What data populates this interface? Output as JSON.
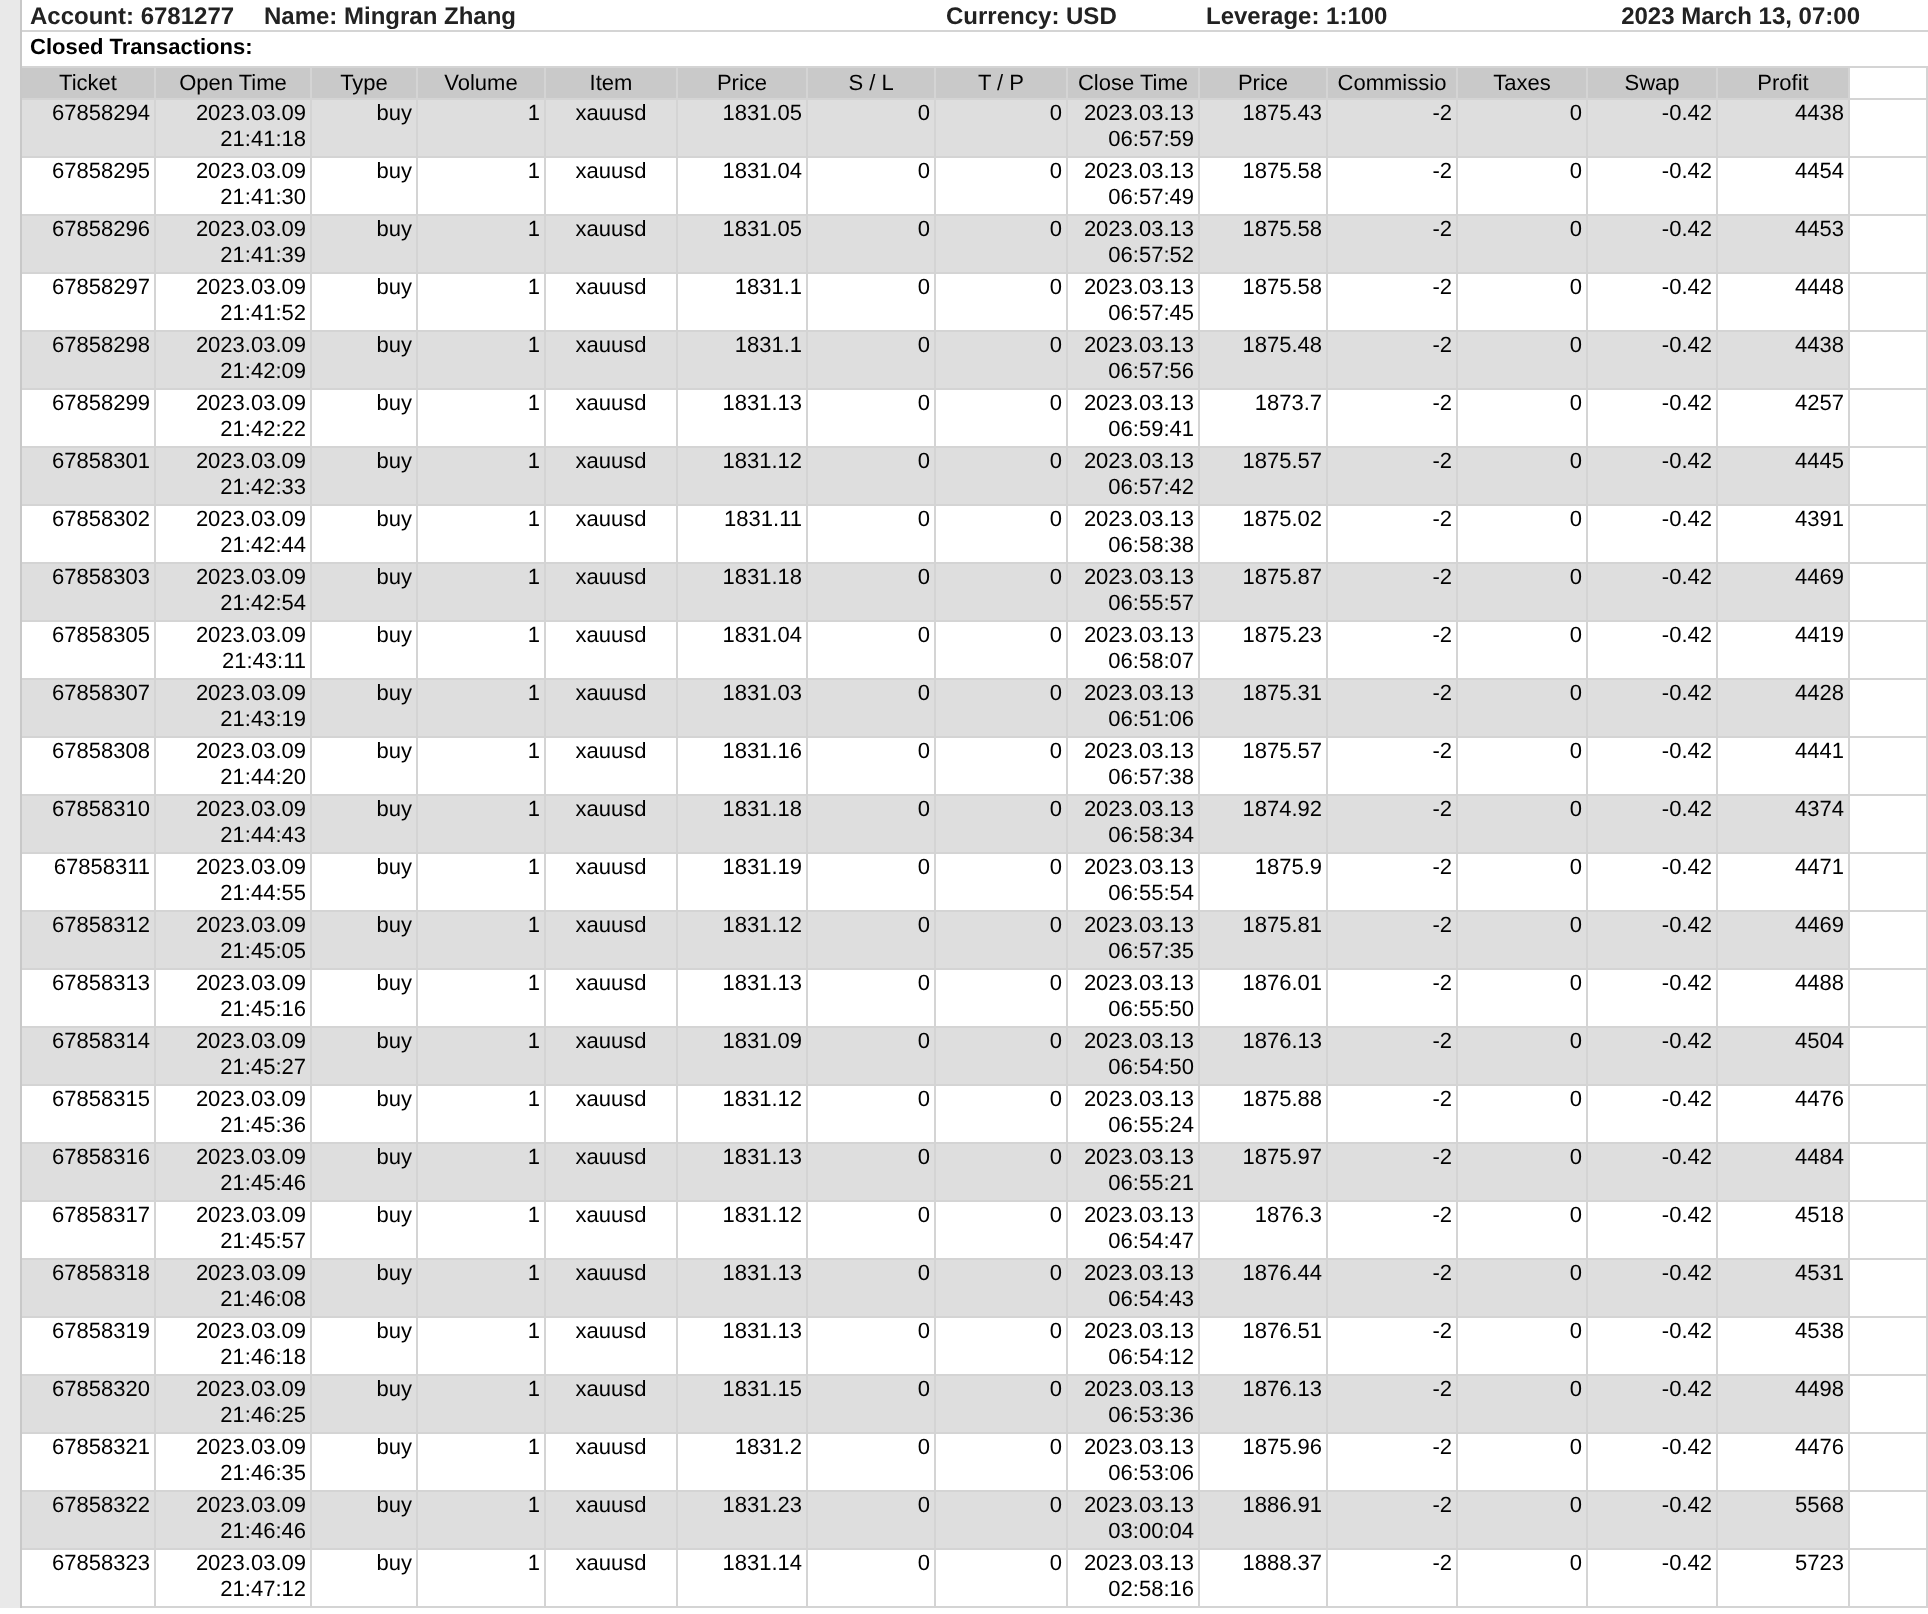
{
  "report_header": {
    "account": "Account: 6781277",
    "name": "Name: Mingran Zhang",
    "currency": "Currency: USD",
    "leverage": "Leverage: 1:100",
    "date": "2023 March 13, 07:00"
  },
  "section_title": "Closed Transactions:",
  "table": {
    "columns": [
      "Ticket",
      "Open Time",
      "Type",
      "Volume",
      "Item",
      "Price",
      "S / L",
      "T / P",
      "Close Time",
      "Price",
      "Commissio",
      "Taxes",
      "Swap",
      "Profit"
    ],
    "rows": [
      {
        "ticket": "67858294",
        "open_time": "2023.03.09 21:41:18",
        "type": "buy",
        "volume": "1",
        "item": "xauusd",
        "open_price": "1831.05",
        "sl": "0",
        "tp": "0",
        "close_time": "2023.03.13 06:57:59",
        "close_price": "1875.43",
        "commission": "-2",
        "taxes": "0",
        "swap": "-0.42",
        "profit": "4438"
      },
      {
        "ticket": "67858295",
        "open_time": "2023.03.09 21:41:30",
        "type": "buy",
        "volume": "1",
        "item": "xauusd",
        "open_price": "1831.04",
        "sl": "0",
        "tp": "0",
        "close_time": "2023.03.13 06:57:49",
        "close_price": "1875.58",
        "commission": "-2",
        "taxes": "0",
        "swap": "-0.42",
        "profit": "4454"
      },
      {
        "ticket": "67858296",
        "open_time": "2023.03.09 21:41:39",
        "type": "buy",
        "volume": "1",
        "item": "xauusd",
        "open_price": "1831.05",
        "sl": "0",
        "tp": "0",
        "close_time": "2023.03.13 06:57:52",
        "close_price": "1875.58",
        "commission": "-2",
        "taxes": "0",
        "swap": "-0.42",
        "profit": "4453"
      },
      {
        "ticket": "67858297",
        "open_time": "2023.03.09 21:41:52",
        "type": "buy",
        "volume": "1",
        "item": "xauusd",
        "open_price": "1831.1",
        "sl": "0",
        "tp": "0",
        "close_time": "2023.03.13 06:57:45",
        "close_price": "1875.58",
        "commission": "-2",
        "taxes": "0",
        "swap": "-0.42",
        "profit": "4448"
      },
      {
        "ticket": "67858298",
        "open_time": "2023.03.09 21:42:09",
        "type": "buy",
        "volume": "1",
        "item": "xauusd",
        "open_price": "1831.1",
        "sl": "0",
        "tp": "0",
        "close_time": "2023.03.13 06:57:56",
        "close_price": "1875.48",
        "commission": "-2",
        "taxes": "0",
        "swap": "-0.42",
        "profit": "4438"
      },
      {
        "ticket": "67858299",
        "open_time": "2023.03.09 21:42:22",
        "type": "buy",
        "volume": "1",
        "item": "xauusd",
        "open_price": "1831.13",
        "sl": "0",
        "tp": "0",
        "close_time": "2023.03.13 06:59:41",
        "close_price": "1873.7",
        "commission": "-2",
        "taxes": "0",
        "swap": "-0.42",
        "profit": "4257"
      },
      {
        "ticket": "67858301",
        "open_time": "2023.03.09 21:42:33",
        "type": "buy",
        "volume": "1",
        "item": "xauusd",
        "open_price": "1831.12",
        "sl": "0",
        "tp": "0",
        "close_time": "2023.03.13 06:57:42",
        "close_price": "1875.57",
        "commission": "-2",
        "taxes": "0",
        "swap": "-0.42",
        "profit": "4445"
      },
      {
        "ticket": "67858302",
        "open_time": "2023.03.09 21:42:44",
        "type": "buy",
        "volume": "1",
        "item": "xauusd",
        "open_price": "1831.11",
        "sl": "0",
        "tp": "0",
        "close_time": "2023.03.13 06:58:38",
        "close_price": "1875.02",
        "commission": "-2",
        "taxes": "0",
        "swap": "-0.42",
        "profit": "4391"
      },
      {
        "ticket": "67858303",
        "open_time": "2023.03.09 21:42:54",
        "type": "buy",
        "volume": "1",
        "item": "xauusd",
        "open_price": "1831.18",
        "sl": "0",
        "tp": "0",
        "close_time": "2023.03.13 06:55:57",
        "close_price": "1875.87",
        "commission": "-2",
        "taxes": "0",
        "swap": "-0.42",
        "profit": "4469"
      },
      {
        "ticket": "67858305",
        "open_time": "2023.03.09 21:43:11",
        "type": "buy",
        "volume": "1",
        "item": "xauusd",
        "open_price": "1831.04",
        "sl": "0",
        "tp": "0",
        "close_time": "2023.03.13 06:58:07",
        "close_price": "1875.23",
        "commission": "-2",
        "taxes": "0",
        "swap": "-0.42",
        "profit": "4419"
      },
      {
        "ticket": "67858307",
        "open_time": "2023.03.09 21:43:19",
        "type": "buy",
        "volume": "1",
        "item": "xauusd",
        "open_price": "1831.03",
        "sl": "0",
        "tp": "0",
        "close_time": "2023.03.13 06:51:06",
        "close_price": "1875.31",
        "commission": "-2",
        "taxes": "0",
        "swap": "-0.42",
        "profit": "4428"
      },
      {
        "ticket": "67858308",
        "open_time": "2023.03.09 21:44:20",
        "type": "buy",
        "volume": "1",
        "item": "xauusd",
        "open_price": "1831.16",
        "sl": "0",
        "tp": "0",
        "close_time": "2023.03.13 06:57:38",
        "close_price": "1875.57",
        "commission": "-2",
        "taxes": "0",
        "swap": "-0.42",
        "profit": "4441"
      },
      {
        "ticket": "67858310",
        "open_time": "2023.03.09 21:44:43",
        "type": "buy",
        "volume": "1",
        "item": "xauusd",
        "open_price": "1831.18",
        "sl": "0",
        "tp": "0",
        "close_time": "2023.03.13 06:58:34",
        "close_price": "1874.92",
        "commission": "-2",
        "taxes": "0",
        "swap": "-0.42",
        "profit": "4374"
      },
      {
        "ticket": "67858311",
        "open_time": "2023.03.09 21:44:55",
        "type": "buy",
        "volume": "1",
        "item": "xauusd",
        "open_price": "1831.19",
        "sl": "0",
        "tp": "0",
        "close_time": "2023.03.13 06:55:54",
        "close_price": "1875.9",
        "commission": "-2",
        "taxes": "0",
        "swap": "-0.42",
        "profit": "4471"
      },
      {
        "ticket": "67858312",
        "open_time": "2023.03.09 21:45:05",
        "type": "buy",
        "volume": "1",
        "item": "xauusd",
        "open_price": "1831.12",
        "sl": "0",
        "tp": "0",
        "close_time": "2023.03.13 06:57:35",
        "close_price": "1875.81",
        "commission": "-2",
        "taxes": "0",
        "swap": "-0.42",
        "profit": "4469"
      },
      {
        "ticket": "67858313",
        "open_time": "2023.03.09 21:45:16",
        "type": "buy",
        "volume": "1",
        "item": "xauusd",
        "open_price": "1831.13",
        "sl": "0",
        "tp": "0",
        "close_time": "2023.03.13 06:55:50",
        "close_price": "1876.01",
        "commission": "-2",
        "taxes": "0",
        "swap": "-0.42",
        "profit": "4488"
      },
      {
        "ticket": "67858314",
        "open_time": "2023.03.09 21:45:27",
        "type": "buy",
        "volume": "1",
        "item": "xauusd",
        "open_price": "1831.09",
        "sl": "0",
        "tp": "0",
        "close_time": "2023.03.13 06:54:50",
        "close_price": "1876.13",
        "commission": "-2",
        "taxes": "0",
        "swap": "-0.42",
        "profit": "4504"
      },
      {
        "ticket": "67858315",
        "open_time": "2023.03.09 21:45:36",
        "type": "buy",
        "volume": "1",
        "item": "xauusd",
        "open_price": "1831.12",
        "sl": "0",
        "tp": "0",
        "close_time": "2023.03.13 06:55:24",
        "close_price": "1875.88",
        "commission": "-2",
        "taxes": "0",
        "swap": "-0.42",
        "profit": "4476"
      },
      {
        "ticket": "67858316",
        "open_time": "2023.03.09 21:45:46",
        "type": "buy",
        "volume": "1",
        "item": "xauusd",
        "open_price": "1831.13",
        "sl": "0",
        "tp": "0",
        "close_time": "2023.03.13 06:55:21",
        "close_price": "1875.97",
        "commission": "-2",
        "taxes": "0",
        "swap": "-0.42",
        "profit": "4484"
      },
      {
        "ticket": "67858317",
        "open_time": "2023.03.09 21:45:57",
        "type": "buy",
        "volume": "1",
        "item": "xauusd",
        "open_price": "1831.12",
        "sl": "0",
        "tp": "0",
        "close_time": "2023.03.13 06:54:47",
        "close_price": "1876.3",
        "commission": "-2",
        "taxes": "0",
        "swap": "-0.42",
        "profit": "4518"
      },
      {
        "ticket": "67858318",
        "open_time": "2023.03.09 21:46:08",
        "type": "buy",
        "volume": "1",
        "item": "xauusd",
        "open_price": "1831.13",
        "sl": "0",
        "tp": "0",
        "close_time": "2023.03.13 06:54:43",
        "close_price": "1876.44",
        "commission": "-2",
        "taxes": "0",
        "swap": "-0.42",
        "profit": "4531"
      },
      {
        "ticket": "67858319",
        "open_time": "2023.03.09 21:46:18",
        "type": "buy",
        "volume": "1",
        "item": "xauusd",
        "open_price": "1831.13",
        "sl": "0",
        "tp": "0",
        "close_time": "2023.03.13 06:54:12",
        "close_price": "1876.51",
        "commission": "-2",
        "taxes": "0",
        "swap": "-0.42",
        "profit": "4538"
      },
      {
        "ticket": "67858320",
        "open_time": "2023.03.09 21:46:25",
        "type": "buy",
        "volume": "1",
        "item": "xauusd",
        "open_price": "1831.15",
        "sl": "0",
        "tp": "0",
        "close_time": "2023.03.13 06:53:36",
        "close_price": "1876.13",
        "commission": "-2",
        "taxes": "0",
        "swap": "-0.42",
        "profit": "4498"
      },
      {
        "ticket": "67858321",
        "open_time": "2023.03.09 21:46:35",
        "type": "buy",
        "volume": "1",
        "item": "xauusd",
        "open_price": "1831.2",
        "sl": "0",
        "tp": "0",
        "close_time": "2023.03.13 06:53:06",
        "close_price": "1875.96",
        "commission": "-2",
        "taxes": "0",
        "swap": "-0.42",
        "profit": "4476"
      },
      {
        "ticket": "67858322",
        "open_time": "2023.03.09 21:46:46",
        "type": "buy",
        "volume": "1",
        "item": "xauusd",
        "open_price": "1831.23",
        "sl": "0",
        "tp": "0",
        "close_time": "2023.03.13 03:00:04",
        "close_price": "1886.91",
        "commission": "-2",
        "taxes": "0",
        "swap": "-0.42",
        "profit": "5568"
      },
      {
        "ticket": "67858323",
        "open_time": "2023.03.09 21:47:12",
        "type": "buy",
        "volume": "1",
        "item": "xauusd",
        "open_price": "1831.14",
        "sl": "0",
        "tp": "0",
        "close_time": "2023.03.13 02:58:16",
        "close_price": "1888.37",
        "commission": "-2",
        "taxes": "0",
        "swap": "-0.42",
        "profit": "5723"
      }
    ]
  }
}
